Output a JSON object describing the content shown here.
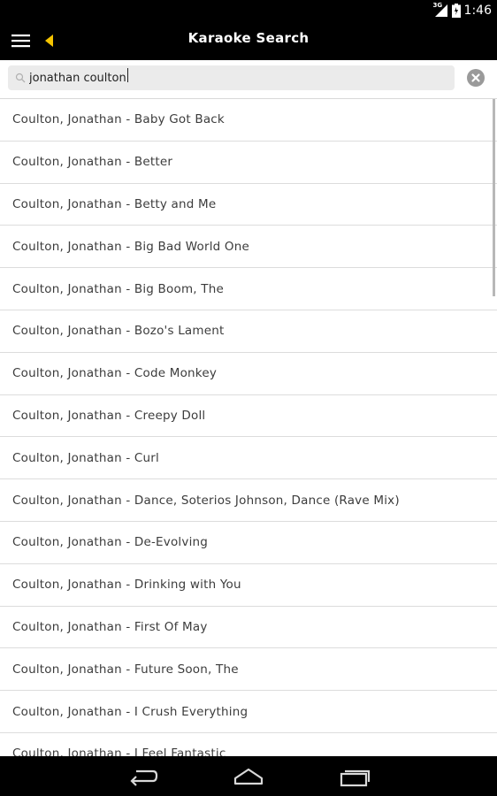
{
  "status_bar": {
    "time": "1:46",
    "network_label": "3G",
    "icons": [
      "signal-icon",
      "battery-icon"
    ]
  },
  "app_bar": {
    "title": "Karaoke Search",
    "accent_color": "#f5c400",
    "icons": [
      "menu-icon",
      "back-arrow-icon"
    ]
  },
  "search": {
    "value": "jonathan coulton",
    "placeholder": "",
    "icons": [
      "search-icon",
      "clear-icon"
    ]
  },
  "results": [
    "Coulton, Jonathan - Baby Got Back",
    "Coulton, Jonathan - Better",
    "Coulton, Jonathan - Betty and Me",
    "Coulton, Jonathan - Big Bad World One",
    "Coulton, Jonathan - Big Boom, The",
    "Coulton, Jonathan - Bozo's Lament",
    "Coulton, Jonathan - Code Monkey",
    "Coulton, Jonathan - Creepy Doll",
    "Coulton, Jonathan - Curl",
    "Coulton, Jonathan - Dance, Soterios Johnson, Dance (Rave Mix)",
    "Coulton, Jonathan - De-Evolving",
    "Coulton, Jonathan - Drinking with You",
    "Coulton, Jonathan - First Of May",
    "Coulton, Jonathan - Future Soon, The",
    "Coulton, Jonathan - I Crush Everything",
    "Coulton, Jonathan - I Feel Fantastic"
  ],
  "nav_bar": {
    "icons": [
      "back-nav-icon",
      "home-nav-icon",
      "recents-nav-icon"
    ]
  }
}
